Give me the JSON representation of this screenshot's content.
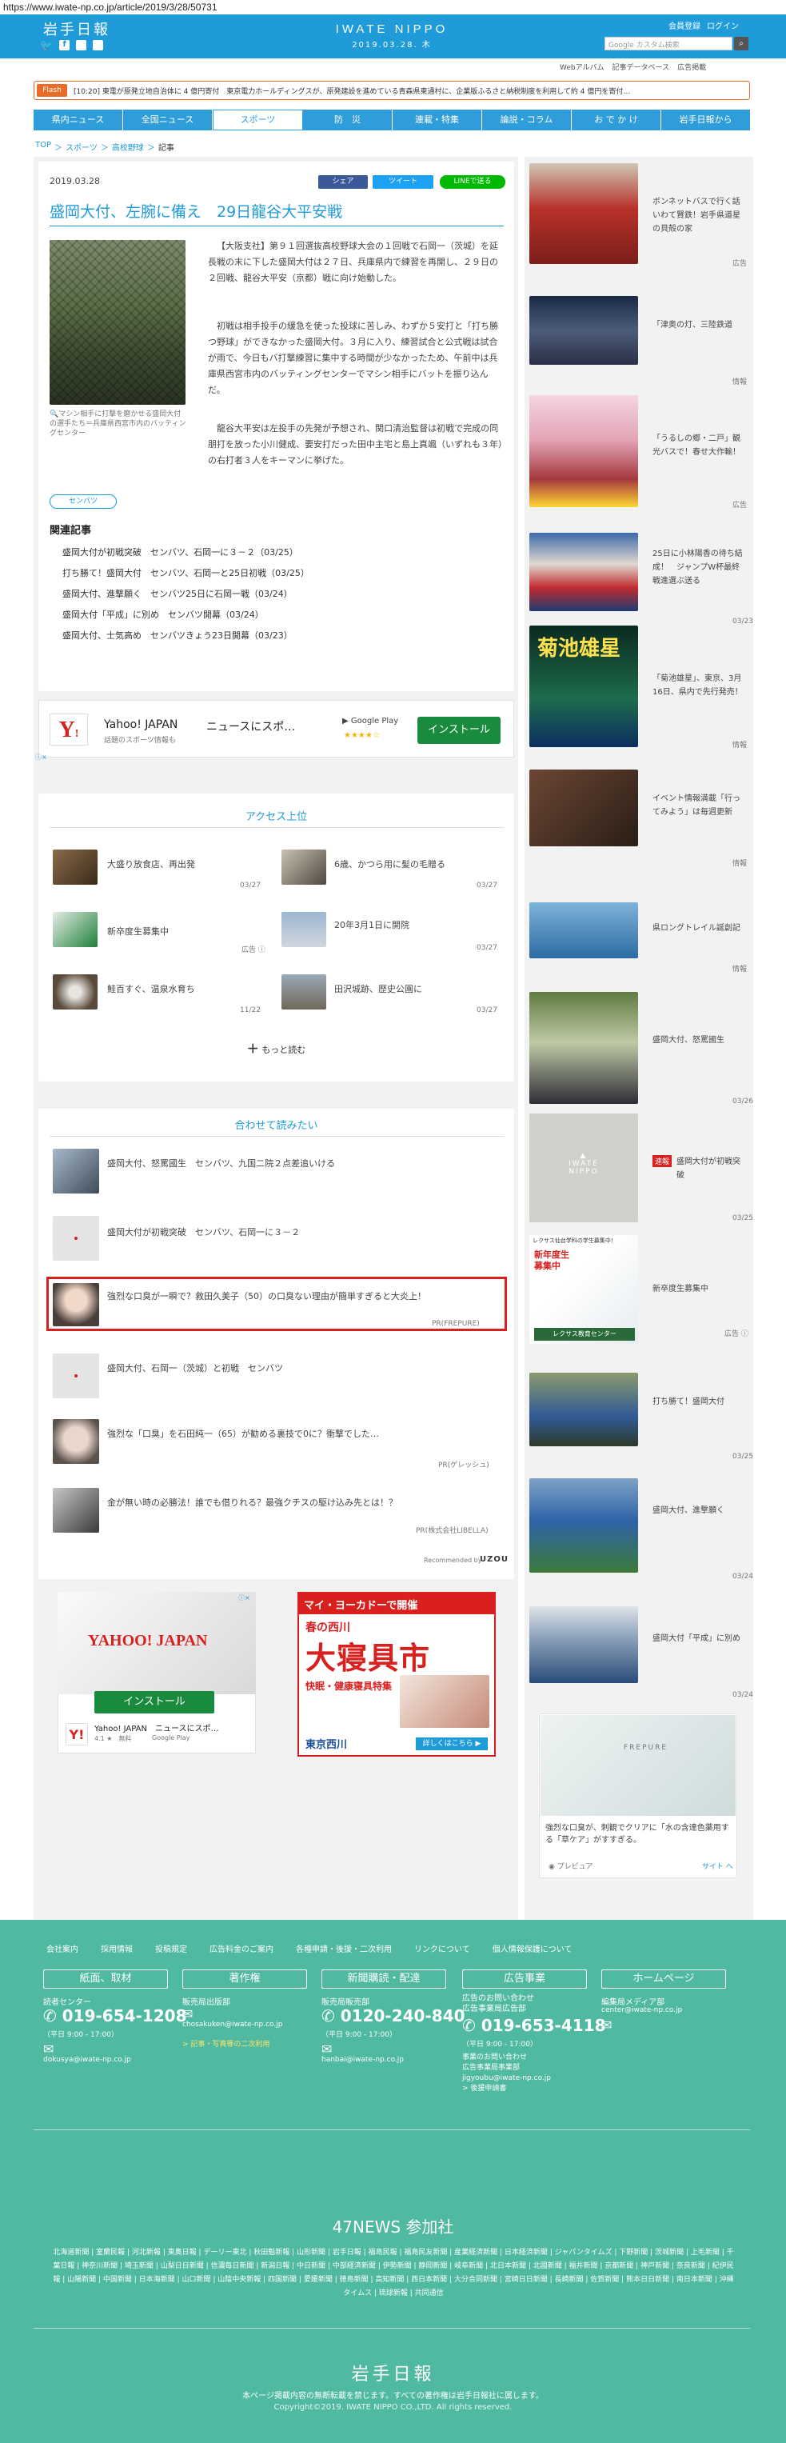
{
  "url": "https://www.iwate-np.co.jp/article/2019/3/28/50731",
  "header": {
    "logo_jp": "岩手日報",
    "logo_en": "IWATE NIPPO",
    "date": "2019.03.28. 木",
    "member_link": "会員登録",
    "login_link": "ログイン",
    "search_placeholder": "カスタム検索",
    "search_prefix": "Google",
    "sublinks": [
      "Webアルバム",
      "記事データベース",
      "広告掲載"
    ]
  },
  "flash": {
    "label": "Flash",
    "text": "[10:20] 東電が原発立地自治体に 4 億円寄付　東京電力ホールディングスが、原発建設を進めている青森県東通村に、企業版ふるさと納税制度を利用して約 4 億円を寄付…"
  },
  "nav": [
    "県内ニュース",
    "全国ニュース",
    "スポーツ",
    "防　災",
    "連載・特集",
    "論説・コラム",
    "お で か け",
    "岩手日報から"
  ],
  "breadcrumb": [
    "TOP",
    "スポーツ",
    "高校野球",
    "記事"
  ],
  "article": {
    "date": "2019.03.28",
    "share_fb": "シェア",
    "share_tw": "ツイート",
    "share_line": "LINEで送る",
    "title": "盛岡大付、左腕に備え　29日龍谷大平安戦",
    "caption": "マシン相手に打撃を磨かせる盛岡大付の選手たち＝兵庫県西宮市内のバッティングセンター",
    "para1": "【大阪支社】第９１回選抜高校野球大会の１回戦で石岡一（茨城）を延長戦の末に下した盛岡大付は２７日、兵庫県内で練習を再開し、２９日の２回戦、龍谷大平安（京都）戦に向け始動した。",
    "para2": "初戦は相手投手の緩急を使った投球に苦しみ、わずか５安打と「打ち勝つ野球」ができなかった盛岡大付。３月に入り、練習試合と公式戦は試合が雨で、今日もバ打撃練習に集中する時間が少なかったため、午前中は兵庫県西宮市内のバッティングセンターでマシン相手にバットを振り込んだ。",
    "para3": "龍谷大平安は左投手の先発が予想され、関口清治監督は初戦で完成の同朋打を放った小川健成、要安打だった田中主宅と島上真颯（いずれも３年）の右打者３人をキーマンに挙げた。",
    "tag": "センバツ",
    "related_heading": "関連記事",
    "related": [
      "盛岡大付が初戦突破　センバツ、石岡一に３－２（03/25）",
      "打ち勝て！盛岡大付　センバツ、石岡一と25日初戦（03/25）",
      "盛岡大付、進撃願く　センバツ25日に石岡一戦（03/24）",
      "盛岡大付「平成」に別め　センバツ開幕（03/24）",
      "盛岡大付、士気高め　センバツきょう23日開幕（03/23）"
    ]
  },
  "ad_banner": {
    "brand": "Yahoo! JAPAN",
    "title": "ニュースにスポ…",
    "sub": "話題のスポーツ情報も",
    "store": "Google Play",
    "install": "インストール",
    "stars": "★★★★☆"
  },
  "access": {
    "heading": "アクセス上位",
    "items": [
      {
        "text": "大盛り放食店、再出発",
        "date": "03/27"
      },
      {
        "text": "6歳、かつら用に髪の毛贈る",
        "date": "03/27"
      },
      {
        "text": "新卒度生募集中",
        "date": "広告 ⓘ"
      },
      {
        "text": "20年3月1日に開院",
        "date": "03/27"
      },
      {
        "text": "鮭百すぐ、温泉水育ち",
        "date": "11/22"
      },
      {
        "text": "田沢城跡、歴史公園に",
        "date": "03/27"
      }
    ],
    "more": "もっと読む"
  },
  "together": {
    "heading": "合わせて読みたい",
    "items": [
      {
        "text": "盛岡大付、怒罵國生　センバツ、九国二院２点差追いける",
        "sub": ""
      },
      {
        "text": "盛岡大付が初戦突破　センバツ、石岡一に３－２",
        "sub": ""
      },
      {
        "text": "強烈な口臭が一瞬で？救田久美子（50）の口臭ない理由が簡単すぎると大炎上！",
        "sub": "PR(FREPURE)"
      },
      {
        "text": "盛岡大付、石岡一（茨城）と初戦　センバツ",
        "sub": ""
      },
      {
        "text": "強烈な「口臭」を石田純一（65）が勧める裏技で0に？衝撃でした…",
        "sub": "PR(ゲレッシュ)"
      },
      {
        "text": "金が無い時の必勝法！誰でも借りれる？最強クチスの駆け込み先とは！？",
        "sub": "PR(株式会社LIBELLA)"
      }
    ],
    "recommended": "Recommended by",
    "uzou": "UZOU"
  },
  "ad_bottom_left": {
    "brand": "YAHOO! JAPAN",
    "install": "インストール",
    "title": "Yahoo! JAPAN　ニュースにスポ…",
    "rating": "4.1 ★　無料",
    "store": "Google Play"
  },
  "ad_bottom_right": {
    "top": "マイ・ヨーカドーで開催",
    "season": "春の西川",
    "headline": "大寝具市",
    "sub": "快眠・健康寝具特集",
    "brand": "東京西川",
    "link": "詳しくはこちら ▶"
  },
  "sidebar": [
    {
      "text": "ボンネットバスで行く話いわて賢鉄！岩手県道星の貝殻の家",
      "date": "広告"
    },
    {
      "text": "「津奥の灯、三陸鉄道",
      "date": "情報"
    },
    {
      "text": "「うるしの郷・二戸」観光バスで！春せ大作輸！",
      "date": "広告"
    },
    {
      "text": "25日に小林陽香の待ち結成！　ジャンプW杯最終戦進選ぶ送る",
      "date": "03/23"
    },
    {
      "text": "「菊池雄星」、東京、3月16日、県内で先行発売！",
      "date": "情報"
    },
    {
      "text": "イベント情報満載「行ってみよう」は毎週更新",
      "date": "情報"
    },
    {
      "text": "県ロングトレイル誕創記",
      "date": "情報"
    },
    {
      "text": "盛岡大付、怒罵國生",
      "date": "03/26"
    },
    {
      "text": "盛岡大付が初戦突破",
      "date": "03/25"
    },
    {
      "text": "新卒度生募集中",
      "date": "広告 ⓘ"
    },
    {
      "text": "打ち勝て！盛岡大付",
      "date": "03/25"
    },
    {
      "text": "盛岡大付、進撃願く",
      "date": "03/24"
    },
    {
      "text": "盛岡大付「平成」に別め",
      "date": "03/24"
    }
  ],
  "sidebar_extra": {
    "new_label": "速報",
    "new_text": "盛岡大付が初戦突破",
    "ad_title": "レクサス仙台学科の学生募集中！",
    "ad_caption": "新年度生募集中",
    "ad_school": "レクサス教育センター"
  },
  "side_ad": {
    "text": "強烈な口臭が、刺観でクリアに「水の含達色薬用する「草ケア」がすすぎる。",
    "source": "プレビュア",
    "site": "サイト へ",
    "brand": "FREPURE"
  },
  "footer": {
    "links": [
      "会社案内",
      "採用情報",
      "投稿規定",
      "広告料金のご案内",
      "各種申請・後援・二次利用",
      "リンクについて",
      "個人情報保護について"
    ],
    "cols": [
      {
        "head": "紙面、取材",
        "label": "読者センター",
        "phone": "019-654-1208",
        "hours": "（平日 9:00 - 17:00）",
        "mail": "dokusya@iwate-np.co.jp",
        "extra": ""
      },
      {
        "head": "著作権",
        "label": "販売局出版部",
        "phone": "",
        "hours": "",
        "mail": "chosakuken@iwate-np.co.jp",
        "extra": "> 記事・写真等の二次利用"
      },
      {
        "head": "新聞購読・配達",
        "label": "販売局販売部",
        "phone": "0120-240-840",
        "hours": "（平日 9:00 - 17:00）",
        "mail": "hanbai@iwate-np.co.jp",
        "extra": ""
      },
      {
        "head": "広告事業",
        "label": "広告のお問い合わせ\n広告事業局広告部",
        "phone": "019-653-4118",
        "hours": "（平日 9:00 - 17:00）",
        "mail": "",
        "extra": "事業のお問い合わせ\n広告事業局事業部\njigyoubu@iwate-np.co.jp\n> 後援申請書"
      },
      {
        "head": "ホームページ",
        "label": "編集局メディア部",
        "phone": "",
        "hours": "",
        "mail": "center@iwate-np.co.jp",
        "extra": ""
      }
    ],
    "news47_heading": "47NEWS 参加社",
    "news47": [
      "北海道新聞",
      "室蘭民報",
      "河北新報",
      "東奥日報",
      "デーリー東北",
      "秋田魁新報",
      "山形新聞",
      "岩手日報",
      "福島民報",
      "福島民友新聞",
      "産業経済新聞",
      "日本経済新聞",
      "ジャパンタイムズ",
      "下野新聞",
      "茨城新聞",
      "上毛新聞",
      "千葉日報",
      "神奈川新聞",
      "埼玉新聞",
      "山梨日日新聞",
      "信濃毎日新聞",
      "新潟日報",
      "中日新聞",
      "中部経済新聞",
      "伊勢新聞",
      "静岡新聞",
      "岐阜新聞",
      "北日本新聞",
      "北國新聞",
      "福井新聞",
      "京都新聞",
      "神戸新聞",
      "奈良新聞",
      "紀伊民報",
      "山陽新聞",
      "中国新聞",
      "日本海新聞",
      "山口新聞",
      "山陰中央新報",
      "四国新聞",
      "愛媛新聞",
      "徳島新聞",
      "高知新聞",
      "西日本新聞",
      "大分合同新聞",
      "宮崎日日新聞",
      "長崎新聞",
      "佐賀新聞",
      "熊本日日新聞",
      "南日本新聞",
      "沖縄タイムス",
      "琉球新報",
      "共同通信"
    ],
    "logo": "岩手日報",
    "notice": "本ページ掲載内容の無断転載を禁じます。すべての著作権は岩手日報社に属します。",
    "copyright": "Copyright©2019. IWATE NIPPO CO.,LTD. All rights reserved."
  },
  "colors": {
    "brand_blue": "#1e9bd8",
    "footer_green": "#4fb9a1",
    "accent_red": "#d9201f",
    "nav_blue": "#2f9dd9",
    "ticker_orange": "#e96b2a"
  }
}
